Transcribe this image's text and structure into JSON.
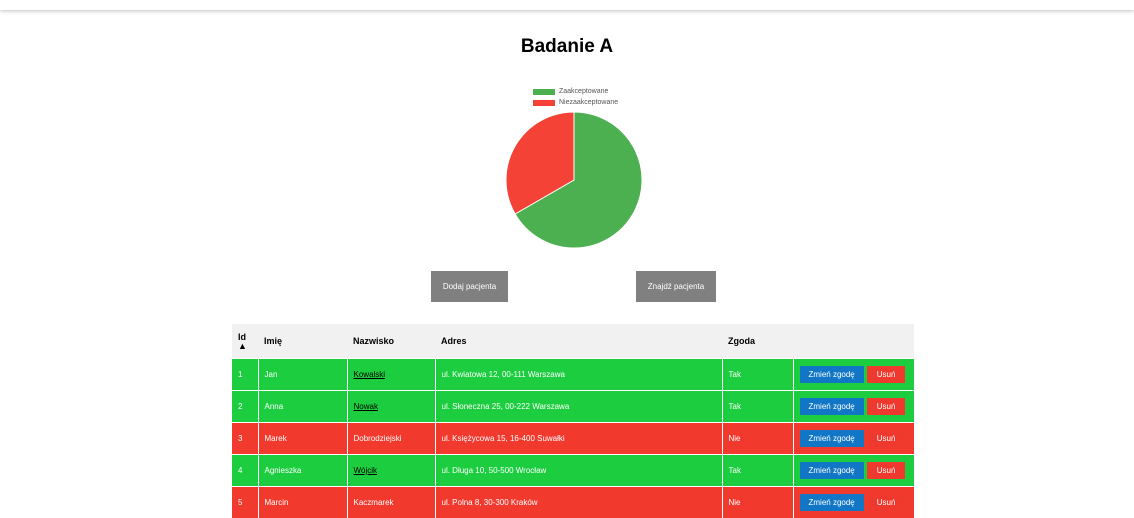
{
  "page": {
    "title": "Badanie A"
  },
  "chart_data": {
    "type": "pie",
    "categories": [
      "Zaakceptowane",
      "Niezaakceptowane"
    ],
    "values": [
      2,
      1
    ],
    "colors": [
      "#4caf50",
      "#f44336"
    ],
    "legend_position": "top"
  },
  "legend": [
    {
      "label": "Zaakceptowane",
      "color": "#4caf50"
    },
    {
      "label": "Niezaakceptowane",
      "color": "#f44336"
    }
  ],
  "actions": {
    "add_patient": "Dodaj pacjenta",
    "find_patient": "Znajdź pacjenta"
  },
  "table": {
    "headers": {
      "id": "Id",
      "sort": "▲",
      "first_name": "Imię",
      "last_name": "Nazwisko",
      "address": "Adres",
      "consent": "Zgoda"
    },
    "rows": [
      {
        "id": "1",
        "first_name": "Jan",
        "last_name": "Kowalski",
        "address": "ul. Kwiatowa 12, 00-111 Warszawa",
        "consent": "Tak",
        "change": "Zmień zgodę",
        "delete": "Usuń"
      },
      {
        "id": "2",
        "first_name": "Anna",
        "last_name": "Nowak",
        "address": "ul. Słoneczna 25, 00-222 Warszawa",
        "consent": "Tak",
        "change": "Zmień zgodę",
        "delete": "Usuń"
      },
      {
        "id": "3",
        "first_name": "Marek",
        "last_name": "Dobrodziejski",
        "address": "ul. Księżycowa 15, 16-400 Suwałki",
        "consent": "Nie",
        "change": "Zmień zgodę",
        "delete": "Usuń"
      },
      {
        "id": "4",
        "first_name": "Agnieszka",
        "last_name": "Wójcik",
        "address": "ul. Długa 10, 50-500 Wrocław",
        "consent": "Tak",
        "change": "Zmień zgodę",
        "delete": "Usuń"
      },
      {
        "id": "5",
        "first_name": "Marcin",
        "last_name": "Kaczmarek",
        "address": "ul. Polna 8, 30-300 Kraków",
        "consent": "Nie",
        "change": "Zmień zgodę",
        "delete": "Usuń"
      }
    ]
  }
}
